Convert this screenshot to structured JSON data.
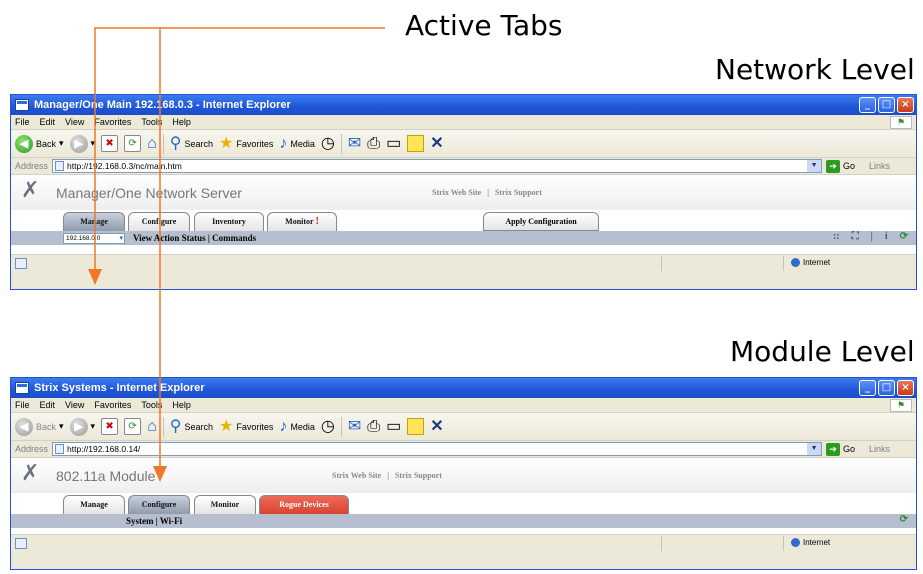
{
  "captions": {
    "active_tabs": "Active Tabs",
    "network_level": "Network Level",
    "module_level": "Module Level"
  },
  "colors": {
    "annotation_arrow": "#f07828",
    "titlebar": "#1f56d8",
    "active_tab": "#8f9aac",
    "rogue_tab": "#d8442f",
    "subnav": "#b6bfcf"
  },
  "browser_common": {
    "menu": [
      "File",
      "Edit",
      "View",
      "Favorites",
      "Tools",
      "Help"
    ],
    "toolbar": {
      "back": "Back",
      "search": "Search",
      "favorites": "Favorites",
      "media": "Media"
    },
    "address_label": "Address",
    "go": "Go",
    "links": "Links",
    "zone": "Internet",
    "icons": [
      "ie-icon",
      "back-icon",
      "forward-icon",
      "stop-icon",
      "refresh-icon",
      "home-icon",
      "search-icon",
      "favorites-star-icon",
      "media-icon",
      "history-icon",
      "mail-icon",
      "print-icon",
      "edit-icon",
      "note-icon",
      "messenger-icon"
    ]
  },
  "network_window": {
    "title": "Manager/One Main 192.168.0.3 - Internet Explorer",
    "address": "http://192.168.0.3/nc/main.htm",
    "server_name": "Manager/One Network Server",
    "links": [
      "Strix Web Site",
      "Strix Support"
    ],
    "link_separator": "|",
    "tabs": [
      {
        "label": "Manage",
        "active": true
      },
      {
        "label": "Configure",
        "active": false
      },
      {
        "label": "Inventory",
        "active": false
      },
      {
        "label": "Monitor",
        "active": false,
        "alert": "!"
      }
    ],
    "apply_button": "Apply Configuration",
    "ip_select": "192.168.0.0",
    "subnav": "View Action Status  |  Commands",
    "subnav_icons": [
      "::",
      "⛶",
      "|",
      "i",
      "⟳"
    ]
  },
  "module_window": {
    "title": "Strix Systems - Internet Explorer",
    "address": "http://192.168.0.14/",
    "server_name": "802.11a Module",
    "links": [
      "Strix Web Site",
      "Strix Support"
    ],
    "link_separator": "|",
    "tabs": [
      {
        "label": "Manage",
        "active": false
      },
      {
        "label": "Configure",
        "active": true
      },
      {
        "label": "Monitor",
        "active": false
      },
      {
        "label": "Rogue Devices",
        "active": false,
        "rogue": true
      }
    ],
    "subnav": "System  |  Wi-Fi",
    "subnav_icons": [
      "⟳"
    ]
  }
}
